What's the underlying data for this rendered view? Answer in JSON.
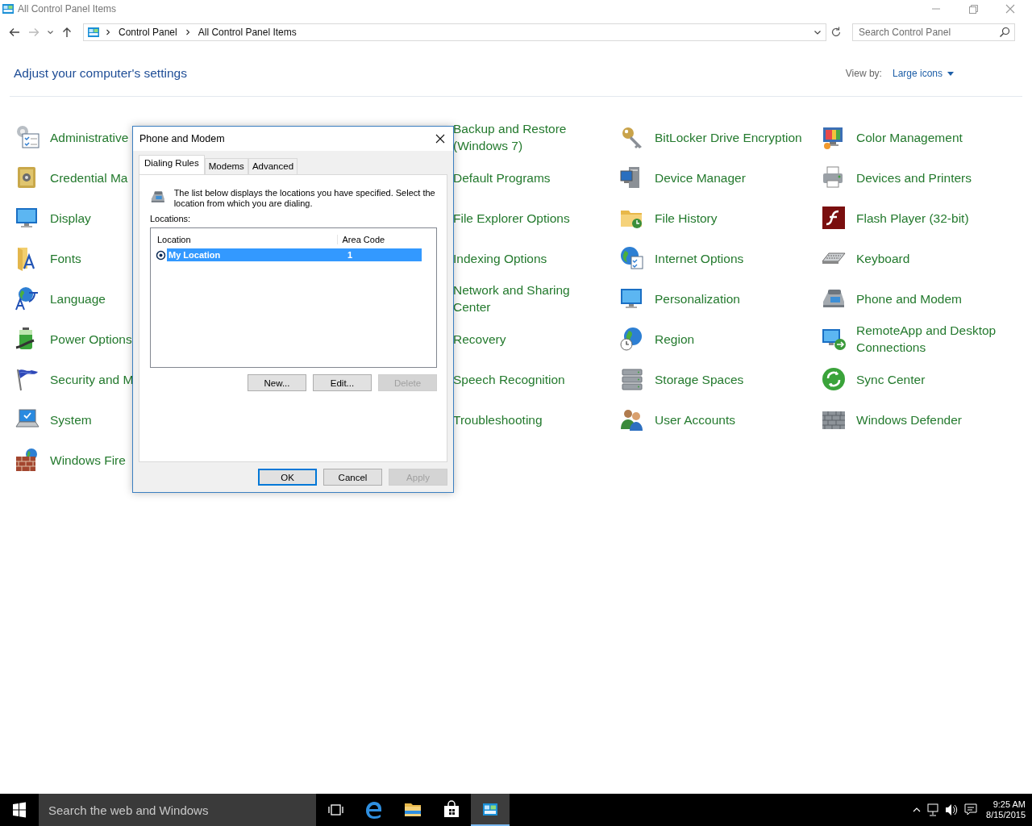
{
  "window": {
    "title": "All Control Panel Items"
  },
  "address": {
    "breadcrumbs": [
      "Control Panel",
      "All Control Panel Items"
    ]
  },
  "search": {
    "placeholder": "Search Control Panel"
  },
  "heading": "Adjust your computer's settings",
  "view_by": {
    "label": "View by:",
    "value": "Large icons"
  },
  "items": [
    {
      "label": "Administrative",
      "icon_visible": true
    },
    {
      "label": "Backup and Restore (Windows 7)",
      "icon_visible": false
    },
    {
      "label": "BitLocker Drive Encryption",
      "icon_visible": true
    },
    {
      "label": "Color Management",
      "icon_visible": true
    },
    {
      "label": "Credential Ma",
      "icon_visible": true
    },
    {
      "label": "Default Programs",
      "icon_visible": false
    },
    {
      "label": "Device Manager",
      "icon_visible": true
    },
    {
      "label": "Devices and Printers",
      "icon_visible": true
    },
    {
      "label": "Display",
      "icon_visible": true
    },
    {
      "label": "File Explorer Options",
      "icon_visible": false
    },
    {
      "label": "File History",
      "icon_visible": true
    },
    {
      "label": "Flash Player (32-bit)",
      "icon_visible": true
    },
    {
      "label": "Fonts",
      "icon_visible": true
    },
    {
      "label": "Indexing Options",
      "icon_visible": false
    },
    {
      "label": "Internet Options",
      "icon_visible": true
    },
    {
      "label": "Keyboard",
      "icon_visible": true
    },
    {
      "label": "Language",
      "icon_visible": true
    },
    {
      "label": "Network and Sharing Center",
      "icon_visible": false
    },
    {
      "label": "Personalization",
      "icon_visible": true
    },
    {
      "label": "Phone and Modem",
      "icon_visible": true
    },
    {
      "label": "Power Options",
      "icon_visible": true
    },
    {
      "label": "Recovery",
      "icon_visible": false
    },
    {
      "label": "Region",
      "icon_visible": true
    },
    {
      "label": "RemoteApp and Desktop Connections",
      "icon_visible": true
    },
    {
      "label": "Security and M",
      "icon_visible": true
    },
    {
      "label": "Speech Recognition",
      "icon_visible": false
    },
    {
      "label": "Storage Spaces",
      "icon_visible": true
    },
    {
      "label": "Sync Center",
      "icon_visible": true
    },
    {
      "label": "System",
      "icon_visible": true
    },
    {
      "label": "Troubleshooting",
      "icon_visible": false
    },
    {
      "label": "User Accounts",
      "icon_visible": true
    },
    {
      "label": "Windows Defender",
      "icon_visible": true
    },
    {
      "label": "Windows Fire",
      "icon_visible": true
    }
  ],
  "dialog": {
    "title": "Phone and Modem",
    "tabs": [
      {
        "label": "Dialing Rules",
        "selected": true
      },
      {
        "label": "Modems",
        "selected": false
      },
      {
        "label": "Advanced",
        "selected": false
      }
    ],
    "description": "The list below displays the locations you have specified. Select the location from which you are dialing.",
    "locations_label": "Locations:",
    "list": {
      "columns": [
        "Location",
        "Area Code"
      ],
      "rows": [
        {
          "cells": [
            "My Location",
            "1"
          ],
          "selected": true
        }
      ]
    },
    "list_buttons": [
      {
        "label": "New...",
        "disabled": false
      },
      {
        "label": "Edit...",
        "disabled": false
      },
      {
        "label": "Delete",
        "disabled": true
      }
    ],
    "buttons": [
      {
        "label": "OK",
        "disabled": false,
        "default": true
      },
      {
        "label": "Cancel",
        "disabled": false,
        "default": false
      },
      {
        "label": "Apply",
        "disabled": true,
        "default": false
      }
    ]
  },
  "taskbar": {
    "search_placeholder": "Search the web and Windows",
    "apps": [
      {
        "active": false
      },
      {
        "active": false
      },
      {
        "active": false
      },
      {
        "active": false
      },
      {
        "active": true
      }
    ],
    "clock": {
      "time": "9:25 AM",
      "date": "8/15/2015"
    }
  }
}
